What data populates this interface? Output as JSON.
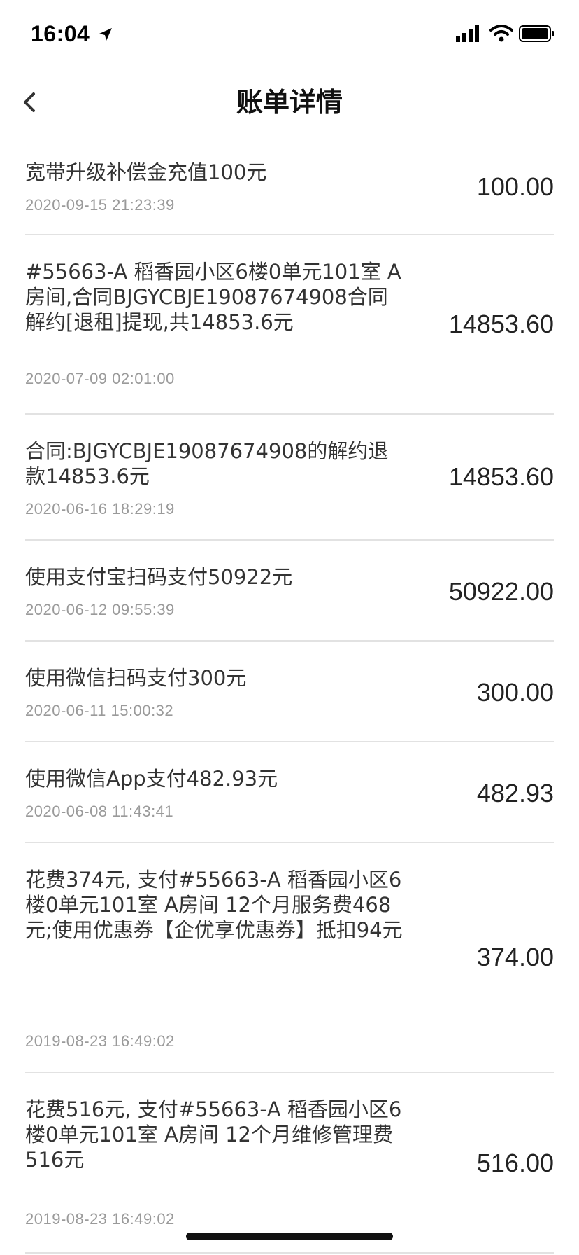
{
  "status_bar": {
    "time": "16:04",
    "icons": [
      "location-arrow-icon",
      "cellular-signal-icon",
      "wifi-icon",
      "battery-icon"
    ]
  },
  "nav": {
    "title": "账单详情",
    "back_icon": "chevron-left-icon"
  },
  "bills": [
    {
      "description": "宽带升级补偿金充值100元",
      "time": "2020-09-15 21:23:39",
      "amount": "100.00"
    },
    {
      "description": "#55663-A 稻香园小区6楼0单元101室 A房间,合同BJGYCBJE19087674908合同解约[退租]提现,共14853.6元",
      "time": "2020-07-09 02:01:00",
      "amount": "14853.60"
    },
    {
      "description": "合同:BJGYCBJE19087674908的解约退款14853.6元",
      "time": "2020-06-16 18:29:19",
      "amount": "14853.60"
    },
    {
      "description": "使用支付宝扫码支付50922元",
      "time": "2020-06-12 09:55:39",
      "amount": "50922.00"
    },
    {
      "description": "使用微信扫码支付300元",
      "time": "2020-06-11 15:00:32",
      "amount": "300.00"
    },
    {
      "description": "使用微信App支付482.93元",
      "time": "2020-06-08 11:43:41",
      "amount": "482.93"
    },
    {
      "description": "花费374元, 支付#55663-A 稻香园小区6楼0单元101室 A房间 12个月服务费468元;使用优惠券【企优享优惠券】抵扣94元",
      "time": "2019-08-23 16:49:02",
      "amount": "374.00"
    },
    {
      "description": "花费516元, 支付#55663-A 稻香园小区6楼0单元101室 A房间 12个月维修管理费516元",
      "time": "2019-08-23 16:49:02",
      "amount": "516.00"
    }
  ]
}
